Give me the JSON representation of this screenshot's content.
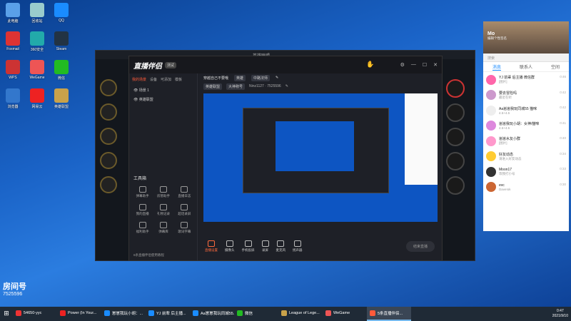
{
  "desktop": {
    "icons": [
      {
        "label": "此电脑",
        "color": "#5aa0e8"
      },
      {
        "label": "回收站",
        "color": "#9cc"
      },
      {
        "label": "QQ",
        "color": "#1a8cff"
      },
      {
        "label": "Foxmail",
        "color": "#d33"
      },
      {
        "label": "360安全",
        "color": "#2aa"
      },
      {
        "label": "Steam",
        "color": "#234"
      },
      {
        "label": "WPS",
        "color": "#c33"
      },
      {
        "label": "WeGame",
        "color": "#e55"
      },
      {
        "label": "微信",
        "color": "#2b2"
      },
      {
        "label": "浏览器",
        "color": "#37c"
      },
      {
        "label": "网易云",
        "color": "#e22"
      },
      {
        "label": "英雄联盟",
        "color": "#c9a24a"
      }
    ]
  },
  "game_window": {
    "title": "英雄联盟"
  },
  "app": {
    "logo": "直播伴侣",
    "version": "测试",
    "side_tabs": [
      "我的场景",
      "设备",
      "可添加",
      "模板"
    ],
    "scenes": [
      "场景 1",
      "英雄联盟"
    ],
    "tools_title": "工具箱",
    "tools": [
      "弹幕助手",
      "房管助手",
      "直播日志",
      "我的直播",
      "礼物记录",
      "超话录屏",
      "福利助手",
      "弹幕库",
      "歌词字幕"
    ],
    "side_footer": "6条直播伴侣使用教程",
    "head_title": "穿越自己不要哦",
    "head_tags": [
      "英雄",
      "中路法师"
    ],
    "sub_items": [
      "英雄联盟",
      "大神称号",
      "Ninz1127 · 7525596"
    ],
    "bottom_buttons": [
      "直播设置",
      "摄像头",
      "手机投屏",
      "录屏",
      "麦克风",
      "扬声器"
    ],
    "start_live": "结束直播"
  },
  "chat": {
    "name": "Mo",
    "status": "编辑个性签名",
    "search": "搜索",
    "tabs": [
      "消息",
      "联系人",
      "空间"
    ],
    "conversations": [
      {
        "name": "YJ 前辈 后主播 微信群",
        "msg": "[图片]",
        "time": "0:46"
      },
      {
        "name": "要去冒险吗",
        "msg": "最近在听",
        "time": "0:42"
      },
      {
        "name": "Aa崽崽我玩同城55 猫咪",
        "msg": "4.5+4.5",
        "time": "0:42"
      },
      {
        "name": "崽崽我玩小胡：女神/猫咪",
        "msg": "4.5+4.5",
        "time": "0:41"
      },
      {
        "name": "崽崽水友小群",
        "msg": "[图片]",
        "time": "0:40"
      },
      {
        "name": "好友动态",
        "msg": "请进入好友动态",
        "time": "0:34"
      },
      {
        "name": "Moon17",
        "msg": "等我打小号",
        "time": "0:33"
      },
      {
        "name": "evc",
        "msg": "Dave!ok",
        "time": "0:30"
      }
    ]
  },
  "overlay": {
    "room_label": "房间号",
    "room_id": "7525596"
  },
  "taskbar": {
    "items": [
      {
        "label": "54650-yyc",
        "color": "#e33",
        "active": false
      },
      {
        "label": "Power (In Your...",
        "color": "#e22",
        "active": false
      },
      {
        "label": "崽崽我玩小胡：...",
        "color": "#1a8cff",
        "active": false
      },
      {
        "label": "YJ 前辈 后主播...",
        "color": "#1a8cff",
        "active": false
      },
      {
        "label": "Aa崽崽我玩同城55...",
        "color": "#1a8cff",
        "active": false
      },
      {
        "label": "微信",
        "color": "#2b2",
        "active": false
      },
      {
        "label": "League of Lege...",
        "color": "#c9a24a",
        "active": false
      },
      {
        "label": "WeGame",
        "color": "#e55",
        "active": false
      },
      {
        "label": "5条直播伴侣...",
        "color": "#ff5a3a",
        "active": true
      }
    ],
    "time": "0:47",
    "date": "2021/9/10"
  }
}
